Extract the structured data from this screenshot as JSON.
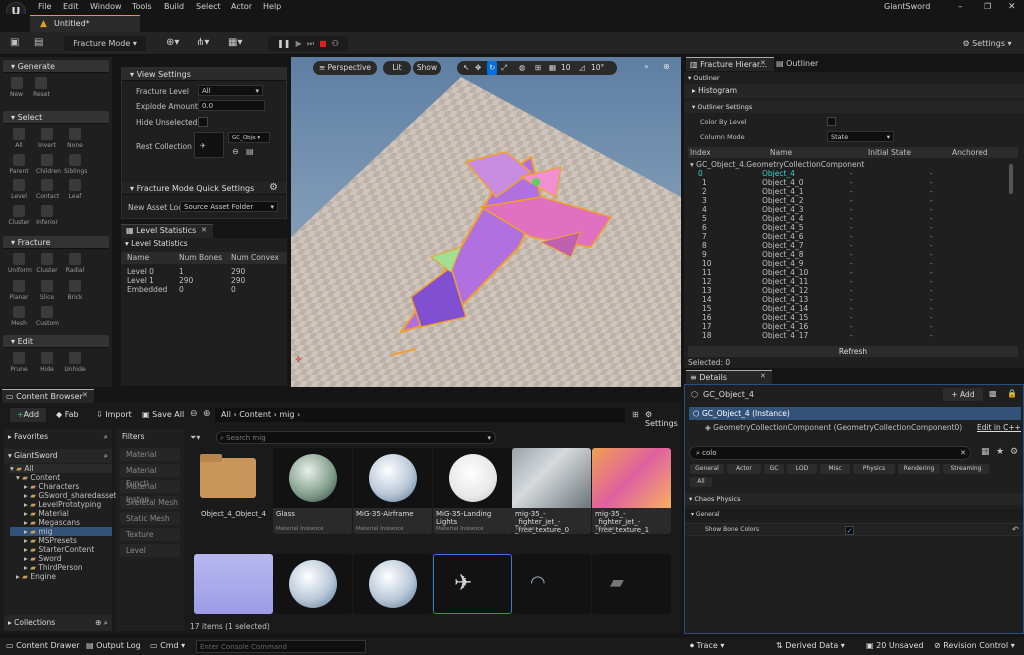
{
  "app": {
    "project": "GiantSword",
    "tab": "Untitled*"
  },
  "menu": [
    "File",
    "Edit",
    "Window",
    "Tools",
    "Build",
    "Select",
    "Actor",
    "Help"
  ],
  "toolbar": {
    "mode": "Fracture Mode",
    "settings": "Settings"
  },
  "left_tools": {
    "generate": {
      "title": "Generate",
      "items": [
        "New",
        "Reset"
      ]
    },
    "select": {
      "title": "Select",
      "items": [
        "All",
        "Invert",
        "None",
        "Parent",
        "Children",
        "Siblings",
        "Level",
        "Contact",
        "Leaf",
        "Cluster",
        "Inferior"
      ]
    },
    "fracture": {
      "title": "Fracture",
      "items": [
        "Uniform",
        "Cluster",
        "Radial",
        "Planar",
        "Slice",
        "Brick",
        "Mesh",
        "Custom"
      ]
    },
    "edit": {
      "title": "Edit",
      "items": [
        "Prune",
        "Hide",
        "Unhide"
      ]
    }
  },
  "view_settings": {
    "title": "View Settings",
    "fracture_level_label": "Fracture Level",
    "fracture_level": "All",
    "explode_label": "Explode Amount",
    "explode": "0.0",
    "hide_label": "Hide Unselected",
    "rest_label": "Rest Collection",
    "rest_value": "GC_Obje"
  },
  "quick_settings": {
    "title": "Fracture Mode Quick Settings",
    "asset_label": "New Asset Loc",
    "asset_value": "Source Asset Folder"
  },
  "level_stats": {
    "tab": "Level Statistics",
    "title": "Level Statistics",
    "headers": [
      "Name",
      "Num Bones",
      "Num Convex"
    ],
    "rows": [
      [
        "Level 0",
        "1",
        "290"
      ],
      [
        "Level 1",
        "290",
        "290"
      ],
      [
        "Embedded",
        "0",
        "0"
      ]
    ]
  },
  "viewport": {
    "perspective": "Perspective",
    "lit": "Lit",
    "show": "Show",
    "grid": "10",
    "angle": "10°"
  },
  "hierarchy": {
    "tab1": "Fracture Hierar...",
    "tab2": "Outliner",
    "section": "Outliner",
    "histogram": "Histogram",
    "settings": "Outliner Settings",
    "color_label": "Color By Level",
    "column_label": "Column Mode",
    "column_value": "State",
    "headers": [
      "Index",
      "Name",
      "Initial State",
      "Anchored"
    ],
    "root": "GC_Object_4.GeometryCollectionComponent",
    "rows": [
      [
        "0",
        "Object_4"
      ],
      [
        "1",
        "Object_4_0"
      ],
      [
        "2",
        "Object_4_1"
      ],
      [
        "3",
        "Object_4_2"
      ],
      [
        "4",
        "Object_4_3"
      ],
      [
        "5",
        "Object_4_4"
      ],
      [
        "6",
        "Object_4_5"
      ],
      [
        "7",
        "Object_4_6"
      ],
      [
        "8",
        "Object_4_7"
      ],
      [
        "9",
        "Object_4_8"
      ],
      [
        "10",
        "Object_4_9"
      ],
      [
        "11",
        "Object_4_10"
      ],
      [
        "12",
        "Object_4_11"
      ],
      [
        "13",
        "Object_4_12"
      ],
      [
        "14",
        "Object_4_13"
      ],
      [
        "15",
        "Object_4_14"
      ],
      [
        "16",
        "Object_4_15"
      ],
      [
        "17",
        "Object_4_16"
      ],
      [
        "18",
        "Object_4_17"
      ]
    ],
    "dash": "-",
    "refresh": "Refresh",
    "selected": "Selected: 0"
  },
  "details": {
    "tab": "Details",
    "object": "GC_Object_4",
    "add": "+ Add",
    "instance": "GC_Object_4 (Instance)",
    "component": "GeometryCollectionComponent (GeometryCollectionComponent0)",
    "edit_cpp": "Edit in C++",
    "search": "colo",
    "filters": [
      "General",
      "Actor",
      "GC",
      "LOD",
      "Misc",
      "Physics",
      "Rendering",
      "Streaming"
    ],
    "all": "All",
    "section": "Chaos Physics",
    "sub": "General",
    "prop": "Show Bone Colors"
  },
  "content_browser": {
    "tab": "Content Browser",
    "add": "Add",
    "fab": "Fab",
    "import": "Import",
    "save": "Save All",
    "path": [
      "All",
      "Content",
      "mig"
    ],
    "settings": "Settings",
    "search_placeholder": "Search mig",
    "favorites": "Favorites",
    "project": "GiantSword",
    "tree": [
      "All",
      "Content",
      "Characters",
      "GSword_sharedasset",
      "LevelPrototyping",
      "Material",
      "Megascans",
      "mig",
      "MSPresets",
      "StarterContent",
      "Sword",
      "ThirdPerson",
      "Engine"
    ],
    "collections": "Collections",
    "filters_title": "Filters",
    "filters": [
      "Material",
      "Material Functi",
      "Material Instan",
      "Skeletal Mesh",
      "Static Mesh",
      "Texture",
      "Level"
    ],
    "assets": [
      {
        "name": "Object_4_Object_4",
        "type": ""
      },
      {
        "name": "Glass",
        "type": "Material Instance"
      },
      {
        "name": "MiG-35-Airframe",
        "type": "Material Instance"
      },
      {
        "name": "MiG-35-Landing Lights",
        "type": "Material Instance"
      },
      {
        "name": "mig-35_-_fighter_jet_-_free_texture_0",
        "type": "Texture"
      },
      {
        "name": "mig-35_-_fighter_jet_-_free_texture_1",
        "type": "Texture"
      }
    ],
    "count": "17 items (1 selected)"
  },
  "statusbar": {
    "drawer": "Content Drawer",
    "log": "Output Log",
    "cmd": "Cmd",
    "console_placeholder": "Enter Console Command",
    "trace": "Trace",
    "derived": "Derived Data",
    "unsaved": "20 Unsaved",
    "revision": "Revision Control"
  }
}
